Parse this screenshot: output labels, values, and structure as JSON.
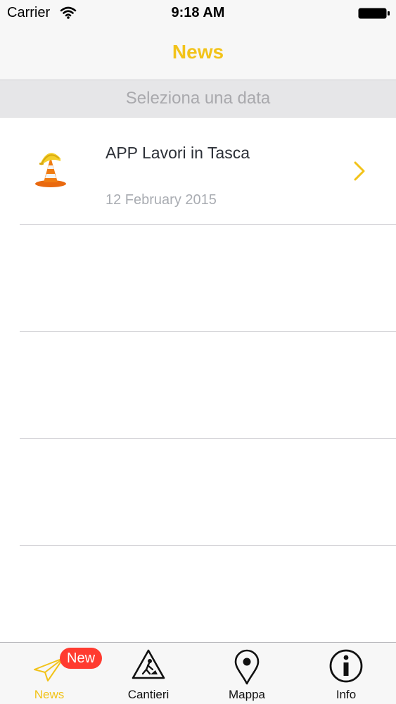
{
  "status_bar": {
    "carrier": "Carrier",
    "time": "9:18 AM",
    "icons": [
      "wifi-icon",
      "battery-icon"
    ]
  },
  "nav": {
    "title": "News",
    "title_color": "#f2c31a"
  },
  "date_selector": {
    "label": "Seleziona una data"
  },
  "news_list": {
    "items": [
      {
        "title": "APP Lavori in Tasca",
        "date": "12 February 2015",
        "icon": "traffic-cone-helmet-icon"
      }
    ],
    "empty_rows": 3
  },
  "tab_bar": {
    "tabs": [
      {
        "label": "News",
        "icon": "paper-plane-icon",
        "active": true,
        "badge": "New"
      },
      {
        "label": "Cantieri",
        "icon": "roadwork-sign-icon",
        "active": false
      },
      {
        "label": "Mappa",
        "icon": "map-pin-icon",
        "active": false
      },
      {
        "label": "Info",
        "icon": "info-icon",
        "active": false
      }
    ],
    "accent_color": "#f2c31a",
    "badge_color": "#ff3b30"
  }
}
